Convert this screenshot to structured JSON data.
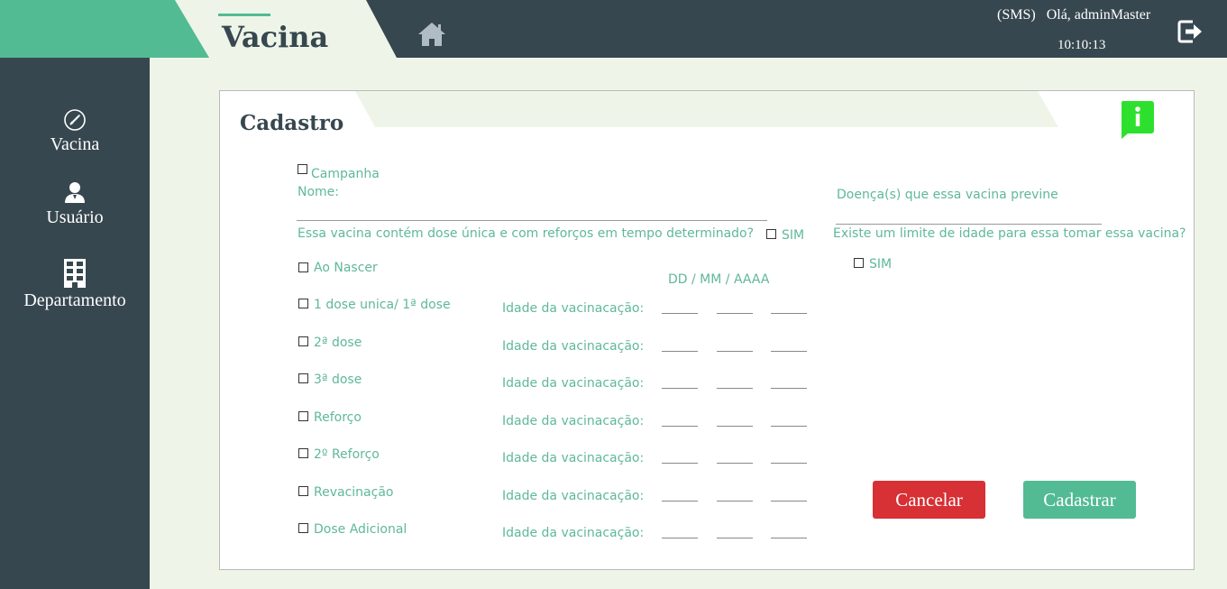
{
  "header": {
    "title": "Vacina",
    "org": "(SMS)",
    "greeting": "Olá, adminMaster",
    "time": "10:10:13"
  },
  "sidebar": {
    "items": [
      {
        "label": "Vacina",
        "icon": "syringe-icon"
      },
      {
        "label": "Usuário",
        "icon": "user-icon"
      },
      {
        "label": "Departamento",
        "icon": "building-icon"
      }
    ]
  },
  "form": {
    "title": "Cadastro",
    "campanha_label": "Campanha",
    "nome_label": "Nome:",
    "doencas_label": "Doença(s) que essa vacina previne",
    "dose_question": "Essa vacina contém dose única e com reforços em tempo determinado?",
    "dose_sim": "SIM",
    "idade_question": "Existe um limite de idade para essa tomar essa vacina?",
    "idade_sim": "SIM",
    "date_format": "DD / MM / AAAA",
    "ao_nascer": "Ao Nascer",
    "age_label": "Idade da vacinacação:",
    "doses": [
      {
        "label": "1 dose unica/ 1ª dose"
      },
      {
        "label": "2ª dose"
      },
      {
        "label": "3ª dose"
      },
      {
        "label": "Reforço"
      },
      {
        "label": "2º Reforço"
      },
      {
        "label": "Revacinação"
      },
      {
        "label": "Dose Adicional"
      }
    ],
    "cancel": "Cancelar",
    "submit": "Cadastrar"
  },
  "colors": {
    "primary_dark": "#37474f",
    "accent_green": "#52bb93",
    "danger": "#d73035",
    "info": "#2ee02e"
  }
}
